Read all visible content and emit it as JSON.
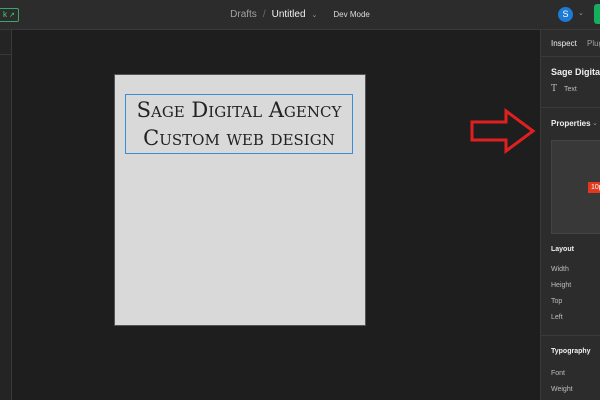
{
  "topbar": {
    "link_label": "k",
    "breadcrumb_root": "Drafts",
    "separator": "/",
    "file_title": "Untitled",
    "dev_mode_label": "Dev Mode",
    "avatar_initial": "S"
  },
  "canvas": {
    "text_lines": [
      "Sage Digital Agency",
      "Custom web design"
    ]
  },
  "inspect_panel": {
    "tab_inspect": "Inspect",
    "tab_plugins": "Plugi",
    "node_name": "Sage Digital",
    "node_type": "Text",
    "node_type_icon": "T",
    "properties_heading": "Properties",
    "spacing_badge": "10p",
    "layout_heading": "Layout",
    "layout_props": [
      "Width",
      "Height",
      "Top",
      "Left"
    ],
    "typography_heading": "Typography",
    "typography_props": [
      "Font",
      "Weight"
    ]
  },
  "colors": {
    "accent_green": "#14ae5c",
    "selection_blue": "#3a8bd9",
    "annotation_red": "#e02020",
    "badge_red": "#e0391c"
  }
}
